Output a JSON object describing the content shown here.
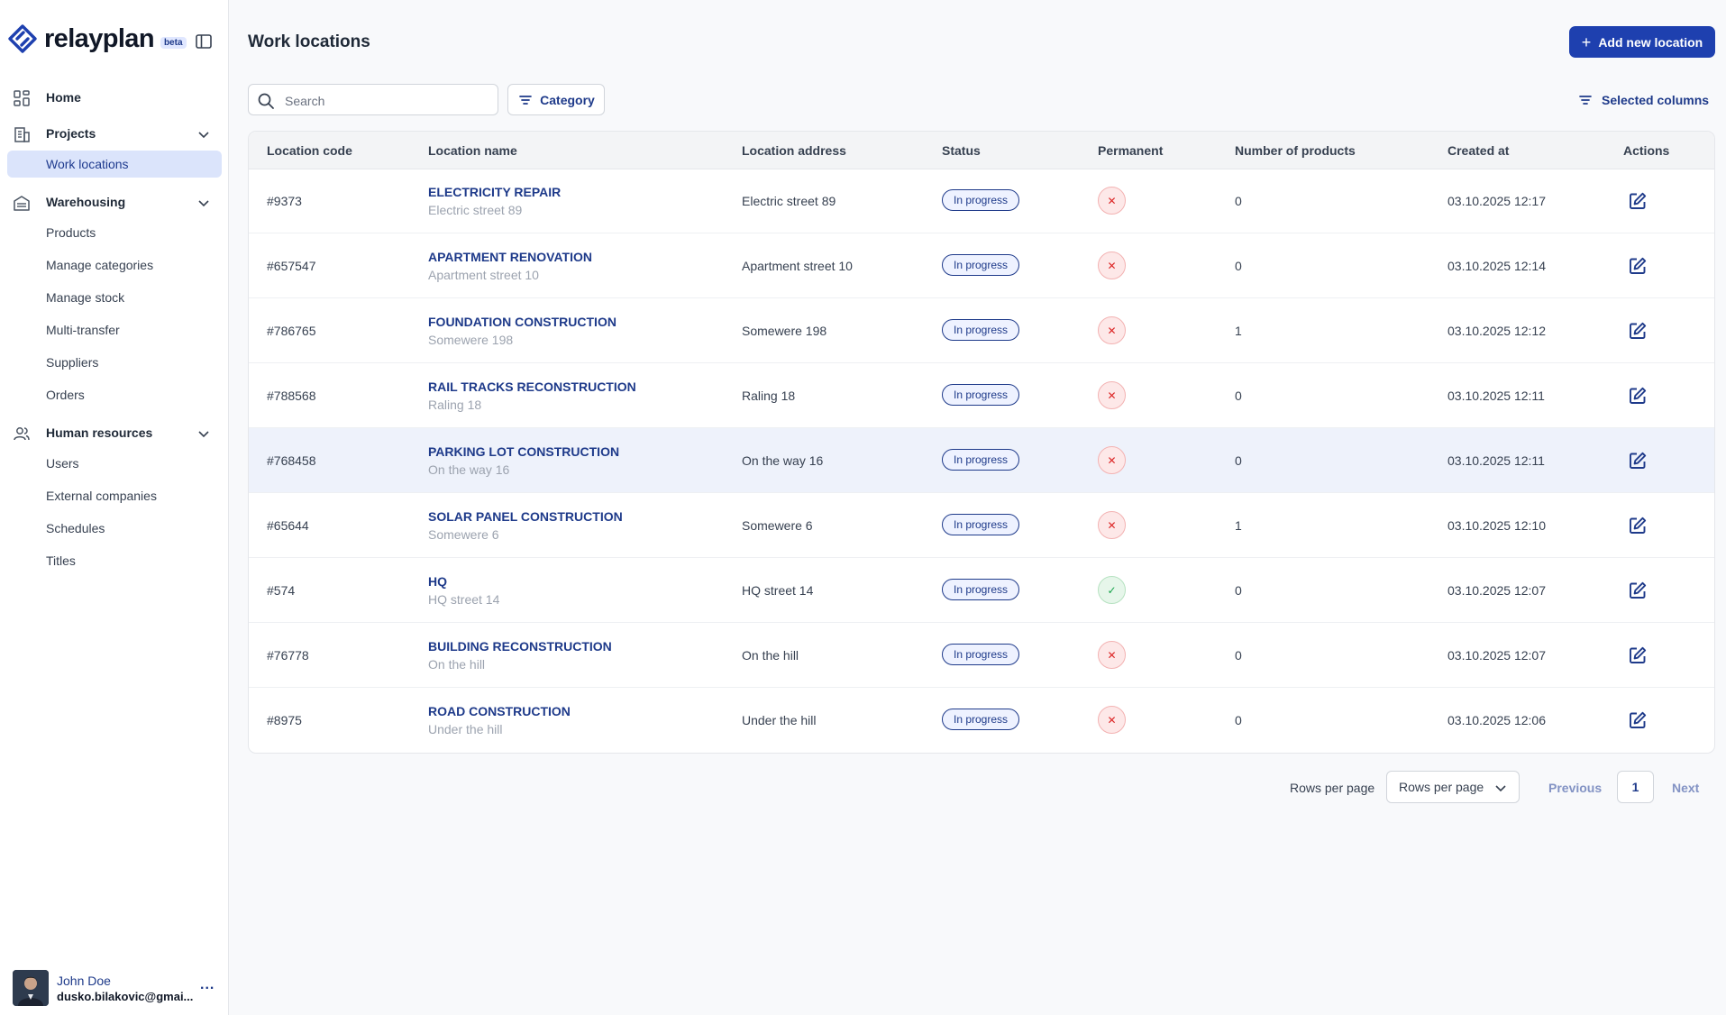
{
  "brand": {
    "name": "relayplan",
    "badge": "beta",
    "color": "#1e40af"
  },
  "sidebar": {
    "home": {
      "label": "Home",
      "icon": "grid-icon"
    },
    "projects": {
      "label": "Projects",
      "icon": "building-icon",
      "items": [
        "Work locations"
      ]
    },
    "warehousing": {
      "label": "Warehousing",
      "icon": "warehouse-icon",
      "items": [
        "Products",
        "Manage categories",
        "Manage stock",
        "Multi-transfer",
        "Suppliers",
        "Orders"
      ]
    },
    "hr": {
      "label": "Human resources",
      "icon": "users-icon",
      "items": [
        "Users",
        "External companies",
        "Schedules",
        "Titles"
      ]
    },
    "active_item": "Work locations"
  },
  "user": {
    "name": "John Doe",
    "email": "dusko.bilakovic@gmai...",
    "more": "..."
  },
  "page": {
    "title": "Work locations",
    "add_button": "Add new location",
    "search_placeholder": "Search",
    "category_button": "Category",
    "columns_button": "Selected columns"
  },
  "table": {
    "columns": [
      "Location code",
      "Location name",
      "Location address",
      "Status",
      "Permanent",
      "Number of products",
      "Created at",
      "Actions"
    ],
    "rows": [
      {
        "code": "#9373",
        "name": "ELECTRICITY REPAIR",
        "sub": "Electric street 89",
        "address": "Electric street 89",
        "status": "In progress",
        "permanent": false,
        "products": "0",
        "created": "03.10.2025 12:17"
      },
      {
        "code": "#657547",
        "name": "APARTMENT RENOVATION",
        "sub": "Apartment street 10",
        "address": "Apartment street 10",
        "status": "In progress",
        "permanent": false,
        "products": "0",
        "created": "03.10.2025 12:14"
      },
      {
        "code": "#786765",
        "name": "FOUNDATION CONSTRUCTION",
        "sub": "Somewere 198",
        "address": "Somewere 198",
        "status": "In progress",
        "permanent": false,
        "products": "1",
        "created": "03.10.2025 12:12"
      },
      {
        "code": "#788568",
        "name": "RAIL TRACKS RECONSTRUCTION",
        "sub": "Raling 18",
        "address": "Raling 18",
        "status": "In progress",
        "permanent": false,
        "products": "0",
        "created": "03.10.2025 12:11"
      },
      {
        "code": "#768458",
        "name": "PARKING LOT CONSTRUCTION",
        "sub": "On the way 16",
        "address": "On the way 16",
        "status": "In progress",
        "permanent": false,
        "products": "0",
        "created": "03.10.2025 12:11",
        "highlighted": true
      },
      {
        "code": "#65644",
        "name": "SOLAR PANEL CONSTRUCTION",
        "sub": "Somewere 6",
        "address": "Somewere 6",
        "status": "In progress",
        "permanent": false,
        "products": "1",
        "created": "03.10.2025 12:10"
      },
      {
        "code": "#574",
        "name": "HQ",
        "sub": "HQ street 14",
        "address": "HQ street 14",
        "status": "In progress",
        "permanent": true,
        "products": "0",
        "created": "03.10.2025 12:07"
      },
      {
        "code": "#76778",
        "name": "BUILDING RECONSTRUCTION",
        "sub": "On the hill",
        "address": "On the hill",
        "status": "In progress",
        "permanent": false,
        "products": "0",
        "created": "03.10.2025 12:07"
      },
      {
        "code": "#8975",
        "name": "ROAD CONSTRUCTION",
        "sub": "Under the hill",
        "address": "Under the hill",
        "status": "In progress",
        "permanent": false,
        "products": "0",
        "created": "03.10.2025 12:06"
      }
    ]
  },
  "pagination": {
    "rows_label": "Rows per page",
    "rows_select": "Rows per page",
    "previous": "Previous",
    "current_page": "1",
    "next": "Next"
  }
}
